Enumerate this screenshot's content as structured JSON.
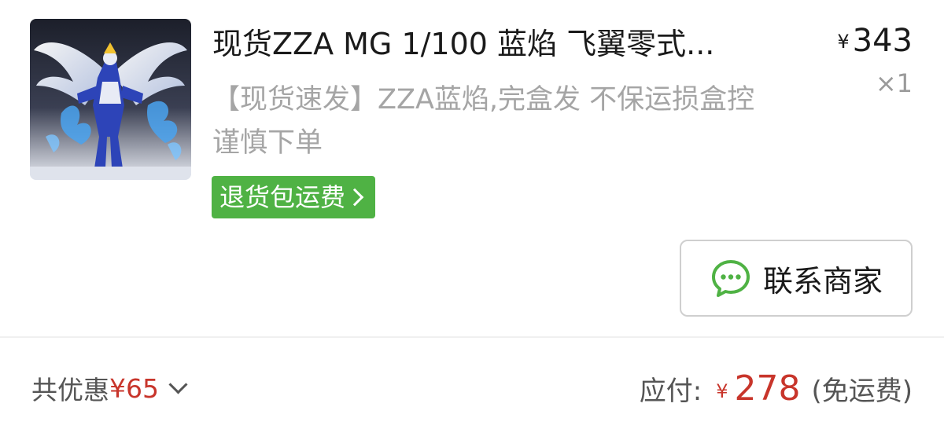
{
  "product": {
    "title": "现货ZZA MG 1/100 蓝焰 飞翼零式...",
    "price_currency": "¥",
    "price": "343",
    "quantity": "×1",
    "subtitle": "【现货速发】ZZA蓝焰,完盒发 不保运损盒控谨慎下单",
    "return_tag": "退货包运费",
    "image_icon": "gundam-figure-image"
  },
  "contact": {
    "label": "联系商家",
    "icon": "chat-bubble-icon",
    "icon_color": "#4fb244"
  },
  "footer": {
    "discount_label": "共优惠",
    "discount_value": "¥65",
    "payable_label": "应付:",
    "payable_currency": "¥",
    "payable_amount": "278",
    "payable_note": "(免运费)"
  },
  "colors": {
    "accent_red": "#c8352b",
    "tag_green": "#4fb244",
    "muted_text": "#a5a5a5"
  }
}
